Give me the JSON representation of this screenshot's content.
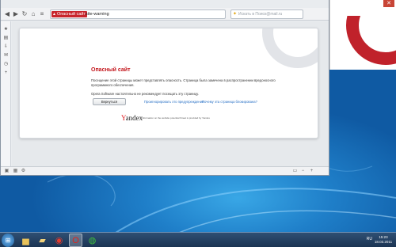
{
  "browser": {
    "address_warning_label": "Опасный сайт",
    "address_text": "site-warning",
    "search_placeholder": "Искать в Поиск@mail.ru"
  },
  "page": {
    "title": "Опасный сайт",
    "message": "Посещение этой страницы может представлять опасность. Страница была замечена в распространении вредоносного программного обеспечения.",
    "recommendation": "Opera Software настоятельно не рекомендует посещать эту страницу.",
    "back_button": "Вернуться",
    "ignore_link": "Проигнорировать это предупреждение",
    "why_link": "Почему эта страница блокирована?",
    "provider_logo": "Yandex",
    "provider_note": "Information on the website potential threat is provided by Yandex"
  },
  "taskbar": {
    "tray_language": "RU",
    "clock_time": "15:23",
    "clock_date": "18.03.2011"
  },
  "colors": {
    "danger_red": "#c3151b",
    "link_blue": "#2b72c6",
    "taskbar": "#1b3453"
  }
}
